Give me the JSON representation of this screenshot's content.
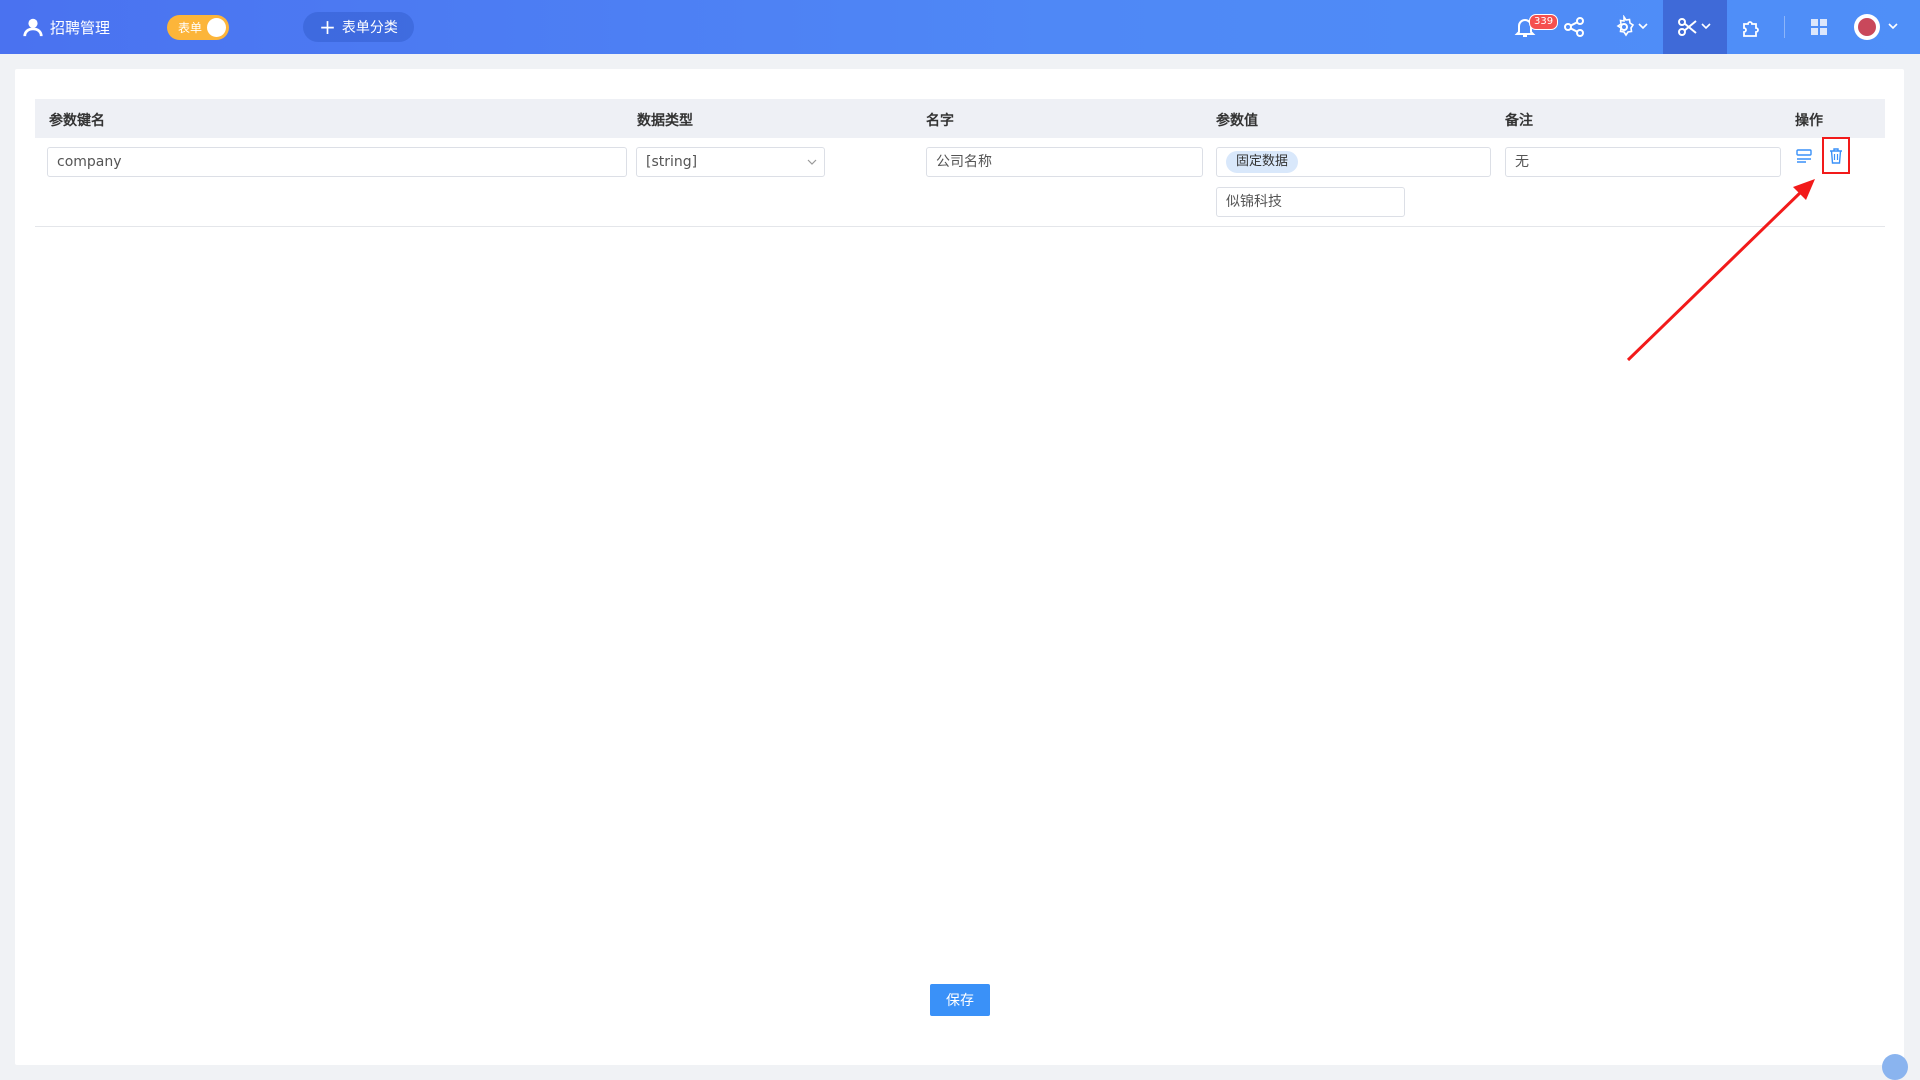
{
  "header": {
    "module_title": "招聘管理",
    "mode_toggle_label": "表单",
    "add_category_label": "表单分类",
    "notification_count": "339"
  },
  "table": {
    "columns": [
      "参数键名",
      "数据类型",
      "名字",
      "参数值",
      "备注",
      "操作"
    ],
    "rows": [
      {
        "key": "company",
        "data_type": "[string]",
        "name": "公司名称",
        "value_tag": "固定数据",
        "value": "似锦科技",
        "remark": "无"
      }
    ]
  },
  "footer": {
    "save_label": "保存"
  },
  "colors": {
    "topbar": "#4f88f6",
    "primary": "#3a91f8",
    "toggle": "#fcb53a",
    "annotation": "#f21a1a"
  }
}
